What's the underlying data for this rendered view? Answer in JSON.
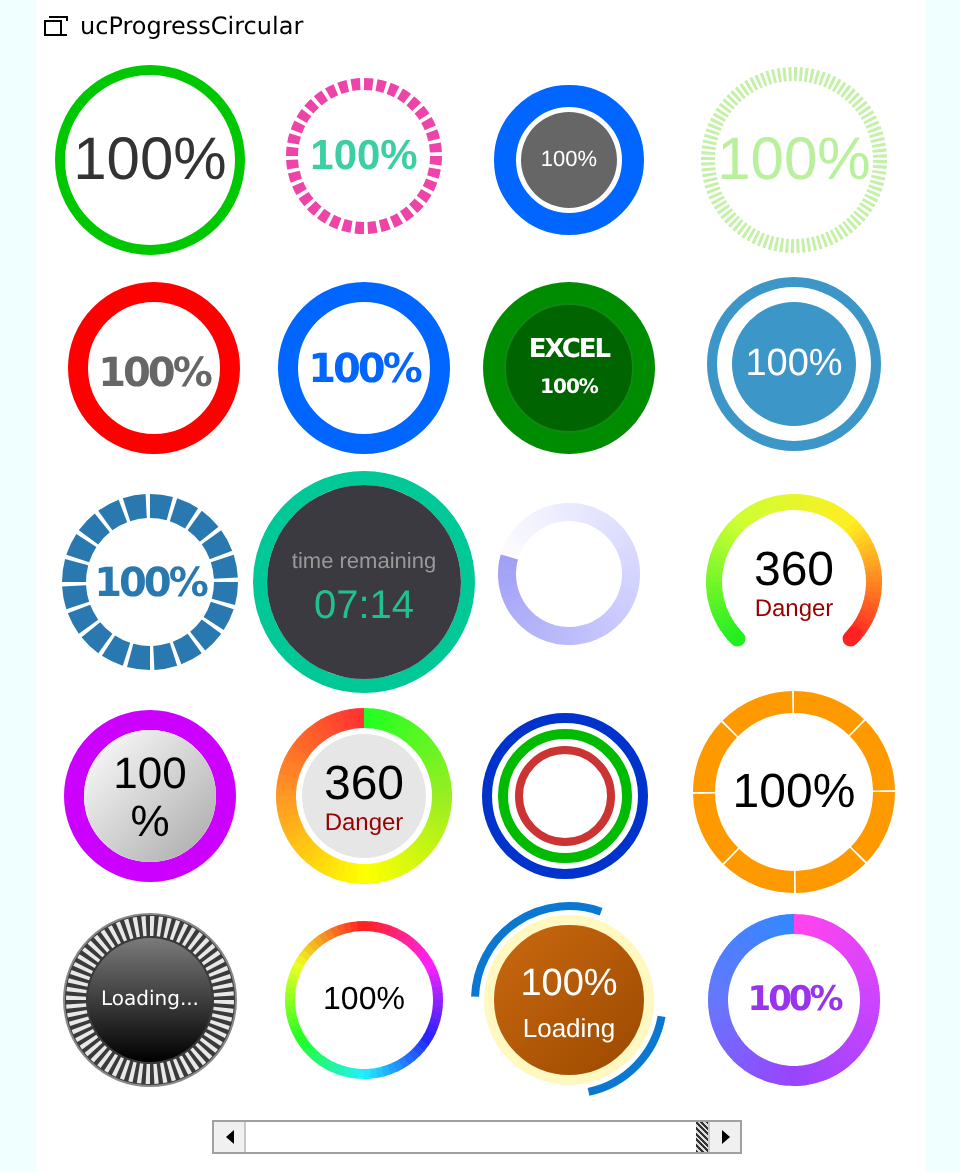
{
  "title": "ucProgressCircular",
  "gauges": [
    {
      "kind": "thin",
      "label": "100%"
    },
    {
      "kind": "dashed",
      "label": "100%"
    },
    {
      "kind": "disc",
      "label": "100%"
    },
    {
      "kind": "ticks",
      "label": "100%"
    },
    {
      "kind": "red",
      "label": "100%"
    },
    {
      "kind": "blue",
      "label": "100%"
    },
    {
      "kind": "excel",
      "caption": "EXCEL",
      "label": "100%"
    },
    {
      "kind": "halo",
      "label": "100%"
    },
    {
      "kind": "blocks",
      "label": "100%"
    },
    {
      "kind": "timer",
      "caption": "time remaining",
      "label": "07:14"
    },
    {
      "kind": "fade"
    },
    {
      "kind": "arc",
      "label": "360",
      "status": "Danger"
    },
    {
      "kind": "purple",
      "lines": [
        "100",
        "%"
      ]
    },
    {
      "kind": "hue",
      "label": "360",
      "status": "Danger"
    },
    {
      "kind": "triple"
    },
    {
      "kind": "orange",
      "label": "100%"
    },
    {
      "kind": "loading",
      "label": "Loading..."
    },
    {
      "kind": "rainbow",
      "label": "100%"
    },
    {
      "kind": "spinner",
      "label": "100%",
      "status": "Loading"
    },
    {
      "kind": "violet",
      "label": "100%"
    }
  ]
}
